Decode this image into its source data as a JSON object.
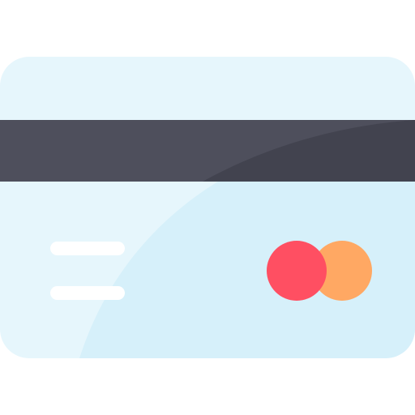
{
  "icon": {
    "name": "credit-card-icon",
    "colors": {
      "card_body": "#e6f6fc",
      "card_shade": "#d6f0fa",
      "magnetic_stripe": "#4e4f5c",
      "magnetic_stripe_shade": "#42434f",
      "text_lines": "#ffffff",
      "logo_left_circle": "#ff4f62",
      "logo_right_circle": "#ffa863"
    }
  }
}
